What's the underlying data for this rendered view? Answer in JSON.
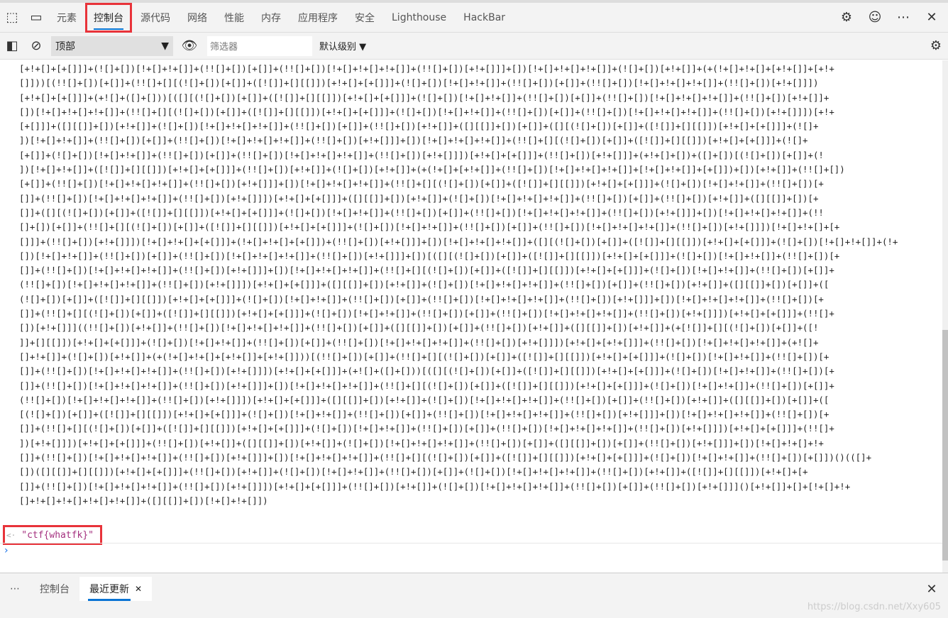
{
  "tabs": [
    "元素",
    "控制台",
    "源代码",
    "网络",
    "性能",
    "内存",
    "应用程序",
    "安全",
    "Lighthouse",
    "HackBar"
  ],
  "active_tab": "控制台",
  "toolbar": {
    "context": "顶部",
    "filter_placeholder": "筛选器",
    "level": "默认级别 ▼"
  },
  "console": {
    "code_lines": [
      "[+!+[]+[+[]]]+(![]+[])[!+[]+!+[]]+(!![]+[])[+[]]+(!![]+[])[!+[]+!+[]+!+[]]+(!![]+[])[+!+[]]]+[])[!+[]+!+[]+!+[]]+(![]+[])[+!+[]]+(+(!+[]+!+[]+[+!+[]]+[+!+",
      "[]]))[(!![]+[])[+[]]+(!![]+[][(![]+[])[+[]]+([![]]+[][[]])[+!+[]+[+[]]]+(![]+[])[!+[]+!+[]]+(!![]+[])[+[]]+(!![]+[])[!+[]+!+[]+!+[]]+(!![]+[])[+!+[]]])",
      "[+!+[]+[+[]]]+(+![]+([]+[]))[([][(![]+[])[+[]]+([![]]+[][[]])[+!+[]+[+[]]]+(![]+[])[!+[]+!+[]]+(!![]+[])[+[]]+(!![]+[])[!+[]+!+[]+!+[]]+(!![]+[])[+!+[]]+",
      "[])[!+[]+!+[]+!+[]]+(!![]+[][(![]+[])[+[]]+([![]]+[][[]])[+!+[]+[+[]]]+(![]+[])[!+[]+!+[]]+(!![]+[])[+[]]+(!![]+[])[!+[]+!+[]+!+[]]+(!![]+[])[+!+[]]])[+!+",
      "[+[]]]+([][[]]+[])[+!+[]]+(![]+[])[!+[]+!+[]+!+[]]+(!![]+[])[+[]]+(!![]+[])[+!+[]]+([][[]]+[])[+[]]+([][(![]+[])[+[]]+([![]]+[][[]])[+!+[]+[+[]]]+(![]+",
      "])[!+[]+!+[]]+(!![]+[])[+[]]+(!![]+[])[!+[]+!+[]+!+[]]+(!![]+[])[+!+[]]]+[])[!+[]+!+[]+!+[]]+(!![]+[][(![]+[])[+[]]+([![]]+[][[]])[+!+[]+[+[]]]+(![]+",
      "[+[]]+(![]+[])[!+[]+!+[]]+(!![]+[])[+[]]+(!![]+[])[!+[]+!+[]+!+[]]+(!![]+[])[+!+[]]])[+!+[]+[+[]]]+(!![]+[])[+!+[]]]+(+!+[]+[])+([]+[])[(![]+[])[+[]]+(!",
      "])[!+[]+!+[]]+([![]]+[][[]])[+!+[]+[+[]]]+(!![]+[])[+!+[]]+(![]+[])[+!+[]]+(+(!+[]+[+!+[]]+(!![]+[])[!+[]+!+[]+!+[]]+[!+[]+!+[]]+[+[]])+[])[+!+[]]+(!![]+[])",
      "[+[]]+(!![]+[])[!+[]+!+[]+!+[]]+(!![]+[])[+!+[]]]+[])[!+[]+!+[]+!+[]]+(!![]+[][(![]+[])[+[]]+([![]]+[][[]])[+!+[]+[+[]]]+(![]+[])[!+[]+!+[]]+(!![]+[])[+",
      "[]]+(!![]+[])[!+[]+!+[]+!+[]]+(!![]+[])[+!+[]]])[+!+[]+[+[]]]+([][[]]+[])[+!+[]]+(![]+[])[!+[]+!+[]+!+[]]+(!![]+[])[+[]]+(!![]+[])[+!+[]]+([][[]]+[])[+",
      "[]]+([][(![]+[])[+[]]+([![]]+[][[]])[+!+[]+[+[]]]+(![]+[])[!+[]+!+[]]+(!![]+[])[+[]]+(!![]+[])[!+[]+!+[]+!+[]]+(!![]+[])[+!+[]]]+[])[!+[]+!+[]+!+[]]+(!!",
      "[]+[])[+[]]+(!![]+[][(![]+[])[+[]]+([![]]+[][[]])[+!+[]+[+[]]]+(![]+[])[!+[]+!+[]]+(!![]+[])[+[]]+(!![]+[])[!+[]+!+[]+!+[]]+(!![]+[])[+!+[]]])[!+[]+!+[]+[+",
      "[]]]+(!![]+[])[+!+[]]])[!+[]+!+[]+[+[]]]+(!+[]+!+[]+[+[]])+(!![]+[])[+!+[]]]+[])[!+[]+!+[]+!+[]]+([][(![]+[])[+[]]+([![]]+[][[]])[+!+[]+[+[]]]+(![]+[])[!+[]+!+[]]+(!+",
      "[])[!+[]+!+[]]+(!![]+[])[+[]]+(!![]+[])[!+[]+!+[]+!+[]]+(!![]+[])[+!+[]]]+[])[([][(![]+[])[+[]]+([![]]+[][[]])[+!+[]+[+[]]]+(![]+[])[!+[]+!+[]]+(!![]+[])[+",
      "[]]+(!![]+[])[!+[]+!+[]+!+[]]+(!![]+[])[+!+[]]]+[])[!+[]+!+[]+!+[]]+(!![]+[][(![]+[])[+[]]+([![]]+[][[]])[+!+[]+[+[]]]+(![]+[])[!+[]+!+[]]+(!![]+[])[+[]]+",
      "(!![]+[])[!+[]+!+[]+!+[]]+(!![]+[])[+!+[]]])[+!+[]+[+[]]]+([][[]]+[])[+!+[]]+(![]+[])[!+[]+!+[]+!+[]]+(!![]+[])[+[]]+(!![]+[])[+!+[]]+([][[]]+[])[+[]]+([",
      "(![]+[])[+[]]+([![]]+[][[]])[+!+[]+[+[]]]+(![]+[])[!+[]+!+[]]+(!![]+[])[+[]]+(!![]+[])[!+[]+!+[]+!+[]]+(!![]+[])[+!+[]]]+[])[!+[]+!+[]+!+[]]+(!![]+[])[+",
      "[]]+(!![]+[][(![]+[])[+[]]+([![]]+[][[]])[+!+[]+[+[]]]+(![]+[])[!+[]+!+[]]+(!![]+[])[+[]]+(!![]+[])[!+[]+!+[]+!+[]]+(!![]+[])[+!+[]]])[+!+[]+[+[]]]+(!![]+",
      "[])[+!+[]]]((!![]+[])[+!+[]]+(!![]+[])[!+[]+!+[]+!+[]]+(!![]+[])[+[]]+([][[]]+[])[+[]]+(!![]+[])[+!+[]]+([][[]]+[])[+!+[]]+(+[![]]+[][(![]+[])[+[]]+([!",
      "]]+[][[]])[+!+[]+[+[]]]+(![]+[])[!+[]+!+[]]+(!![]+[])[+[]]+(!![]+[])[!+[]+!+[]+!+[]]+(!![]+[])[+!+[]]])[+!+[]+[+!+[]]]+(!![]+[])[!+[]+!+[]+!+[]]+(+![]+",
      "[]+!+[]]+(![]+[])[+!+[]]+(+(!+[]+!+[]+[+!+[]]+[+!+[]]))[(!![]+[])[+[]]+(!![]+[][(![]+[])[+[]]+([![]]+[][[]])[+!+[]+[+[]]]+(![]+[])[!+[]+!+[]]+(!![]+[])[+",
      "[]]+(!![]+[])[!+[]+!+[]+!+[]]+(!![]+[])[+!+[]]])[+!+[]+[+[]]]+(+![]+([]+[]))[([][(![]+[])[+[]]+([![]]+[][[]])[+!+[]+[+[]]]+(![]+[])[!+[]+!+[]]+(!![]+[])[+",
      "[]]+(!![]+[])[!+[]+!+[]+!+[]]+(!![]+[])[+!+[]]]+[])[!+[]+!+[]+!+[]]+(!![]+[][(![]+[])[+[]]+([![]]+[][[]])[+!+[]+[+[]]]+(![]+[])[!+[]+!+[]]+(!![]+[])[+[]]+",
      "(!![]+[])[!+[]+!+[]+!+[]]+(!![]+[])[+!+[]]])[+!+[]+[+[]]]+([][[]]+[])[+!+[]]+(![]+[])[!+[]+!+[]+!+[]]+(!![]+[])[+[]]+(!![]+[])[+!+[]]+([][[]]+[])[+[]]+([",
      "[(![]+[])[+[]]+([![]]+[][[]])[+!+[]+[+[]]]+(![]+[])[!+[]+!+[]]+(!![]+[])[+[]]+(!![]+[])[!+[]+!+[]+!+[]]+(!![]+[])[+!+[]]]+[])[!+[]+!+[]+!+[]]+(!![]+[])[+",
      "[]]+(!![]+[][(![]+[])[+[]]+([![]]+[][[]])[+!+[]+[+[]]]+(![]+[])[!+[]+!+[]]+(!![]+[])[+[]]+(!![]+[])[!+[]+!+[]+!+[]]+(!![]+[])[+!+[]]])[+!+[]+[+[]]]+(!![]+",
      "])[+!+[]]])[+!+[]+[+[]]]+(!![]+[])[+!+[]]+([][[]]+[])[+!+[]]+(![]+[])[!+[]+!+[]+!+[]]+(!![]+[])[+[]]+([][[]]+[])[+[]]+(!![]+[])[+!+[]]]+[])[!+[]+!+[]+!+",
      "[]]+(!![]+[])[!+[]+!+[]+!+[]]+(!![]+[])[+!+[]]]+[])[!+[]+!+[]+!+[]]+(!![]+[][(![]+[])[+[]]+([![]]+[][[]])[+!+[]+[+[]]]+(![]+[])[!+[]+!+[]]+(!![]+[])[+[]])()(([]+",
      "[])([][[]]+[][[]])[+!+[]+[+[]]]+(!![]+[])[+!+[]]+(![]+[])[!+[]+!+[]]+(!![]+[])[+[]]+(![]+[])[!+[]+!+[]+!+[]]+(!![]+[])[+!+[]]+([![]]+[][[]])[+!+[]+[+",
      "[]]+(!![]+[])[!+[]+!+[]+!+[]]+(!![]+[])[+!+[]]])[+!+[]+[+[]]]+(!![]+[])[+!+[]]+(![]+[])[!+[]+!+[]+!+[]]+(!![]+[])[+[]]+(!![]+[])[+!+[]]]()[+!+[]]+[]+[!+[]+!+",
      "[]+!+[]+!+[]+!+[]+!+[]]+([][[]]+[])[!+[]+!+[]])"
    ],
    "result": "\"ctf{whatfk}\""
  },
  "drawer": {
    "tabs": [
      "控制台",
      "最近更新"
    ],
    "active": "最近更新"
  },
  "watermark": "https://blog.csdn.net/Xxy605"
}
